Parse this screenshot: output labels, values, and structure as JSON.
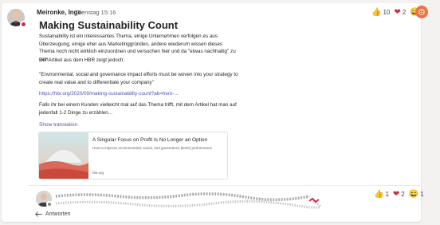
{
  "post": {
    "author": "Meironke, Ingo",
    "time": "Dienstag 15:16",
    "title": "Making Sustainability Count",
    "paragraphs": [
      "Sustainability ist ein interessantes Thema, einige Unternehmen verfolgen es aus Überzeugung, einige eher aus Marketinggründen, andere wiederum wissen dieses Thema noch nicht wirklich einzuordnen und versuchen hier und da \"etwas nachhaltig\" zu sein.",
      "Der Artikel aus dem HBR zeigt jedoch:",
      "\"Environmental, social and governance impact efforts must be woven into your strategy to create real value and to differentiate your company\"",
      "https://hbr.org/2020/09/making-sustainability-count?ab=hero-...",
      "Falls ihr bei einem Kunden vielleicht mal auf das Thema trifft, mit dem Artikel hat man auf jedenfall 1-2 Dinge zu erzählen..."
    ],
    "show_translation": "Show translation",
    "reactions": [
      {
        "icon": "thumbs-up-icon",
        "glyph": "👍",
        "count": "10"
      },
      {
        "icon": "heart-icon",
        "glyph": "❤",
        "count": "2"
      },
      {
        "icon": "laugh-icon",
        "glyph": "😄",
        "count": "1"
      }
    ]
  },
  "link_preview": {
    "title": "A Singular Focus on Profit Is No Longer an Option",
    "description": "How to improve environmental, social, and governance (ESG) performance",
    "domain": "hbr.org"
  },
  "reply": {
    "reactions": [
      {
        "icon": "thumbs-up-icon",
        "glyph": "👍",
        "count": "1"
      },
      {
        "icon": "heart-icon",
        "glyph": "❤",
        "count": "2"
      },
      {
        "icon": "laugh-icon",
        "glyph": "😄",
        "count": "1"
      }
    ]
  },
  "reply_button": "Antworten",
  "colors": {
    "accent": "#4f52b2",
    "presence_busy": "#c4314b",
    "heart": "#c4314b",
    "user_badge": "#e8744a"
  }
}
